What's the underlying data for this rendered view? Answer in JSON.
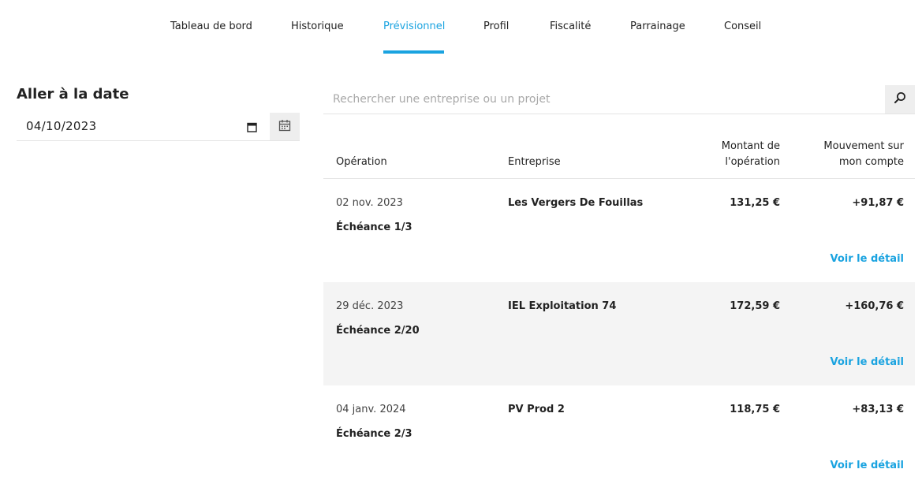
{
  "nav": {
    "items": [
      {
        "label": "Tableau de bord",
        "active": false
      },
      {
        "label": "Historique",
        "active": false
      },
      {
        "label": "Prévisionnel",
        "active": true
      },
      {
        "label": "Profil",
        "active": false
      },
      {
        "label": "Fiscalité",
        "active": false
      },
      {
        "label": "Parrainage",
        "active": false
      },
      {
        "label": "Conseil",
        "active": false
      }
    ]
  },
  "date_panel": {
    "title": "Aller à la date",
    "value": "04/10/2023",
    "button_icon": "calendar-icon"
  },
  "search": {
    "placeholder": "Rechercher une entreprise ou un projet",
    "button_icon": "search-icon"
  },
  "table": {
    "headers": {
      "operation": "Opération",
      "company": "Entreprise",
      "amount_line1": "Montant de",
      "amount_line2": "l'opération",
      "movement_line1": "Mouvement sur",
      "movement_line2": "mon compte"
    },
    "rows": [
      {
        "date": "02 nov. 2023",
        "step": "Échéance 1/3",
        "company": "Les Vergers De Fouillas",
        "amount": "131,25 €",
        "movement": "+91,87 €",
        "link": "Voir le détail"
      },
      {
        "date": "29 déc. 2023",
        "step": "Échéance 2/20",
        "company": "IEL Exploitation 74",
        "amount": "172,59 €",
        "movement": "+160,76 €",
        "link": "Voir le détail"
      },
      {
        "date": "04 janv. 2024",
        "step": "Échéance 2/3",
        "company": "PV Prod 2",
        "amount": "118,75 €",
        "movement": "+83,13 €",
        "link": "Voir le détail"
      }
    ]
  },
  "colors": {
    "accent": "#1aa3e0",
    "row_shade": "#f4f4f4",
    "button_bg": "#eeeeee"
  }
}
